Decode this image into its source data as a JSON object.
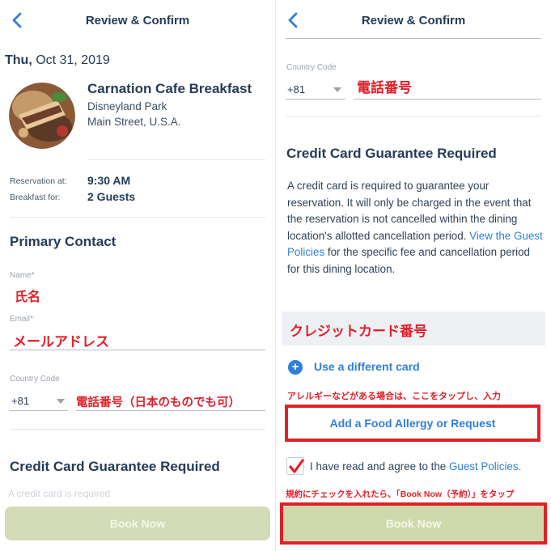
{
  "header": {
    "title": "Review & Confirm"
  },
  "left": {
    "date_day": "Thu,",
    "date_rest": " Oct 31, 2019",
    "restaurant": {
      "name": "Carnation Cafe Breakfast",
      "park": "Disneyland Park",
      "area": "Main Street, U.S.A."
    },
    "reservation_label": "Reservation at:",
    "reservation_value": "9:30 AM",
    "party_label": "Breakfast for:",
    "party_value": "2 Guests",
    "primary_contact_title": "Primary Contact",
    "name_label": "Name*",
    "name_annotation": "氏名",
    "email_label": "Email*",
    "email_annotation": "メールアドレス",
    "country_code_label": "Country Code",
    "country_code_value": "+81",
    "phone_annotation": "電話番号（日本のものでも可）",
    "credit_title": "Credit Card Guarantee Required",
    "faded_text": "A credit card is required",
    "book_now": "Book Now"
  },
  "right": {
    "country_code_label": "Country Code",
    "country_code_value": "+81",
    "phone_annotation": "電話番号",
    "credit_title": "Credit Card Guarantee Required",
    "paragraph_1": "A credit card is required to guarantee your reservation. It will only be charged in the event that the reservation is not cancelled within the dining location's allotted cancellation period. ",
    "policy_link": "View the Guest Policies",
    "paragraph_2": " for the specific fee and cancellation period for this dining location.",
    "card_number_annotation": "クレジットカード番号",
    "use_different_card": "Use a different card",
    "allergy_annotation": "アレルギーなどがある場合は、ここをタップし、入力",
    "allergy_button": "Add a Food Allergy or Request",
    "agree_text": "I have read and agree to the ",
    "agree_link": "Guest Policies.",
    "checkbox_annotation": "規約にチェックを入れたら、「Book Now（予約）」をタップ",
    "book_now": "Book Now"
  },
  "colors": {
    "text": "#253b56",
    "link": "#2f7ed8",
    "annotation_red": "#e0202a",
    "book_button": "#d3dbb7"
  },
  "icons": [
    "chevron-left-icon",
    "plus-circle-icon",
    "checkmark-icon"
  ]
}
